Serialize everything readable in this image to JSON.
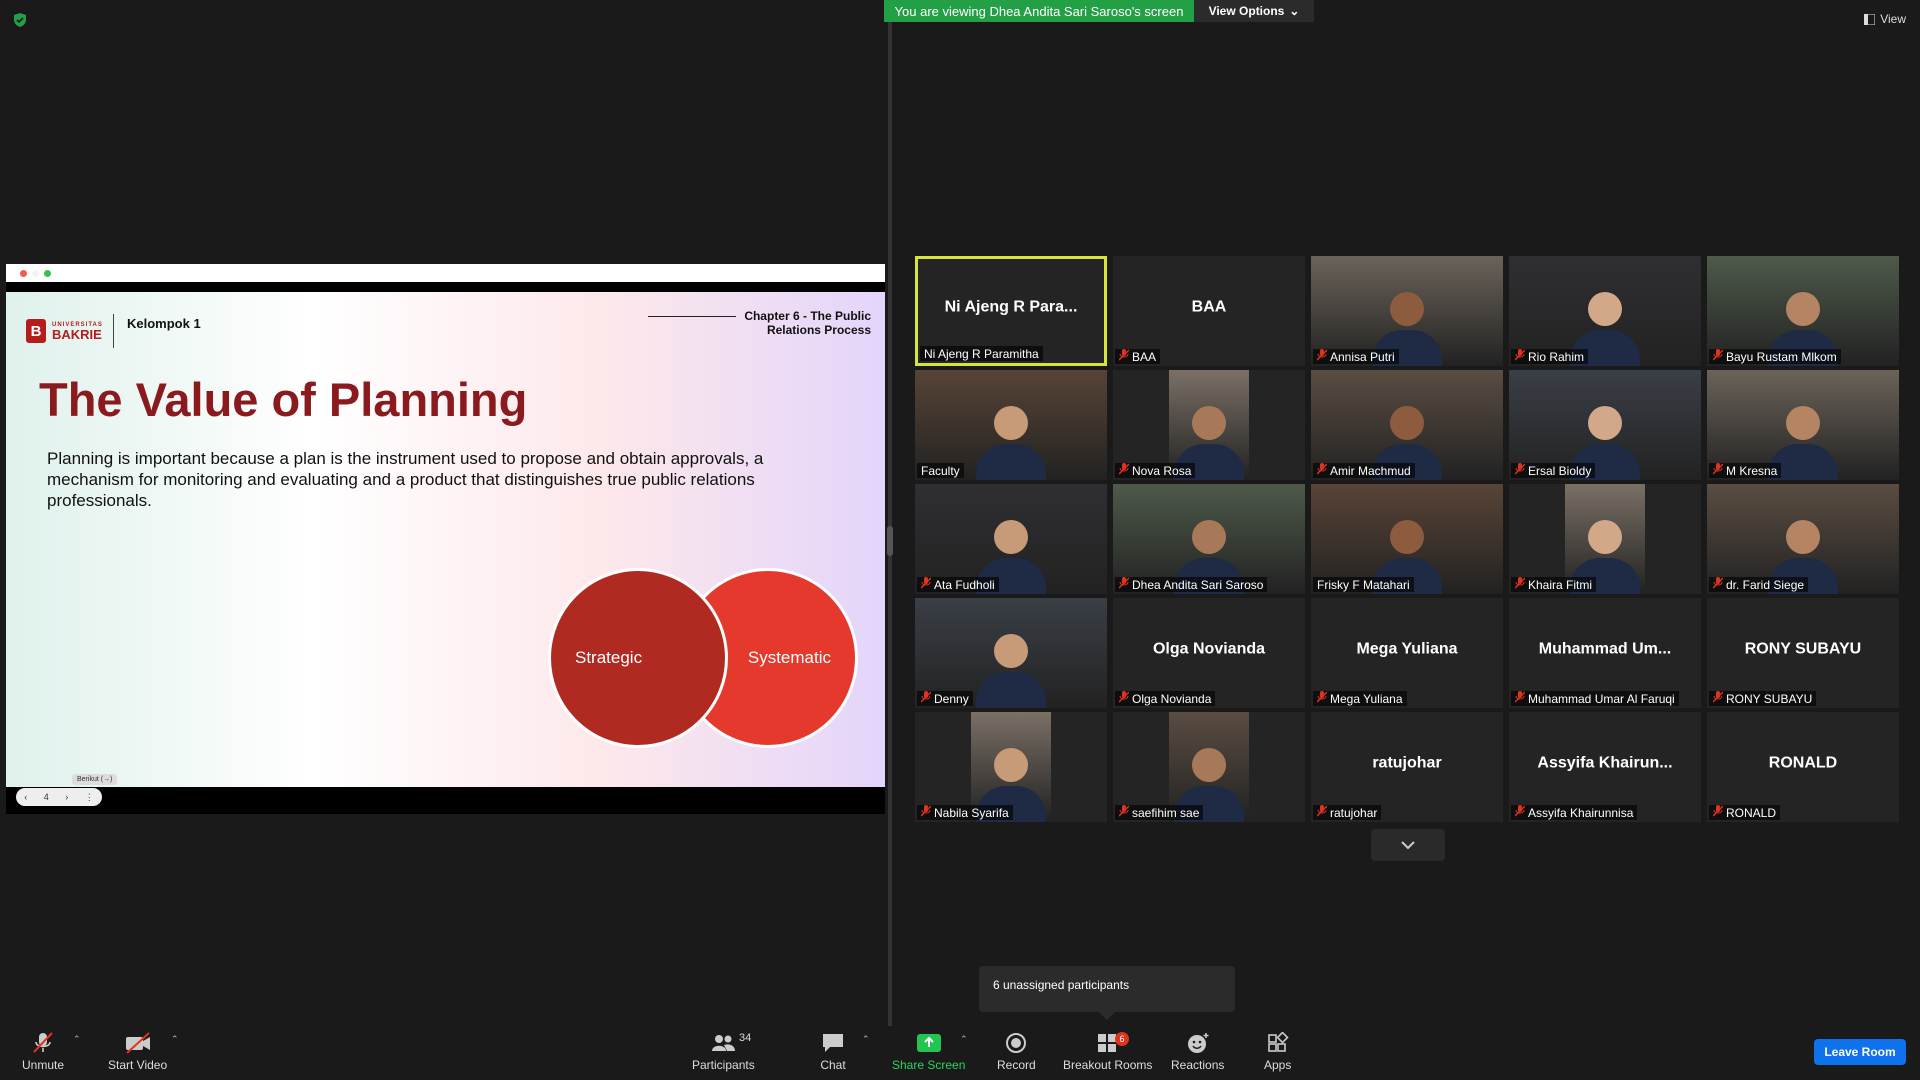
{
  "banner": {
    "viewing": "You are viewing Dhea Andita Sari Saroso's screen",
    "view_options": "View Options",
    "view": "View"
  },
  "slide": {
    "logo_small": "UNIVERSITAS",
    "logo_big": "BAKRIE",
    "group": "Kelompok 1",
    "chapter_line1": "Chapter 6 - The Public",
    "chapter_line2": "Relations Process",
    "title": "The Value of Planning",
    "body": "Planning is important because a plan is the instrument used to propose and obtain approvals, a mechanism for monitoring and evaluating and a product that distinguishes true public relations professionals.",
    "circle_left": "Strategic",
    "circle_right": "Systematic",
    "page": "4",
    "tooltip": "Berikut (→)"
  },
  "participants": [
    {
      "name": "Ni Ajeng R Paramitha",
      "big": "Ni Ajeng R Para...",
      "video": false,
      "muted": false
    },
    {
      "name": "BAA",
      "big": "BAA",
      "video": false,
      "muted": true
    },
    {
      "name": "Annisa Putri",
      "video": true,
      "muted": true
    },
    {
      "name": "Rio Rahim",
      "video": true,
      "muted": true
    },
    {
      "name": "Bayu Rustam Mlkom",
      "video": true,
      "muted": true
    },
    {
      "name": "Faculty",
      "video": true,
      "muted": false
    },
    {
      "name": "Nova Rosa",
      "video": true,
      "muted": true
    },
    {
      "name": "Amir Machmud",
      "video": true,
      "muted": true
    },
    {
      "name": "Ersal Bioldy",
      "video": true,
      "muted": true
    },
    {
      "name": "M Kresna",
      "video": true,
      "muted": true
    },
    {
      "name": "Ata Fudholi",
      "video": true,
      "muted": true
    },
    {
      "name": "Dhea Andita Sari Saroso",
      "video": true,
      "muted": true
    },
    {
      "name": "Frisky F Matahari",
      "video": true,
      "muted": false
    },
    {
      "name": "Khaira Fitmi",
      "video": true,
      "muted": true
    },
    {
      "name": "dr. Farid Siege",
      "video": true,
      "muted": true
    },
    {
      "name": "Denny",
      "video": true,
      "muted": true
    },
    {
      "name": "Olga Novianda",
      "big": "Olga Novianda",
      "video": false,
      "muted": true
    },
    {
      "name": "Mega Yuliana",
      "big": "Mega Yuliana",
      "video": false,
      "muted": true
    },
    {
      "name": "Muhammad Umar Al Faruqi",
      "big": "Muhammad  Um...",
      "video": false,
      "muted": true
    },
    {
      "name": "RONY SUBAYU",
      "big": "RONY SUBAYU",
      "video": false,
      "muted": true
    },
    {
      "name": "Nabila Syarifa",
      "video": true,
      "muted": true
    },
    {
      "name": "saefihim sae",
      "video": true,
      "muted": true
    },
    {
      "name": "ratujohar",
      "big": "ratujohar",
      "video": false,
      "muted": true
    },
    {
      "name": "Assyifa Khairunnisa",
      "big": "Assyifa  Khairun...",
      "video": false,
      "muted": true
    },
    {
      "name": "RONALD",
      "big": "RONALD",
      "video": false,
      "muted": true
    }
  ],
  "unassigned": "6 unassigned participants",
  "toolbar": {
    "unmute": "Unmute",
    "start_video": "Start Video",
    "participants": "Participants",
    "participants_count": "34",
    "chat": "Chat",
    "share_screen": "Share Screen",
    "record": "Record",
    "breakout": "Breakout Rooms",
    "breakout_count": "6",
    "reactions": "Reactions",
    "apps": "Apps",
    "leave": "Leave Room"
  },
  "colors": {
    "share_green": "#23a046",
    "leave_blue": "#0e72ed",
    "active_speaker": "#d7e53a",
    "mute_red": "#e0331f"
  }
}
